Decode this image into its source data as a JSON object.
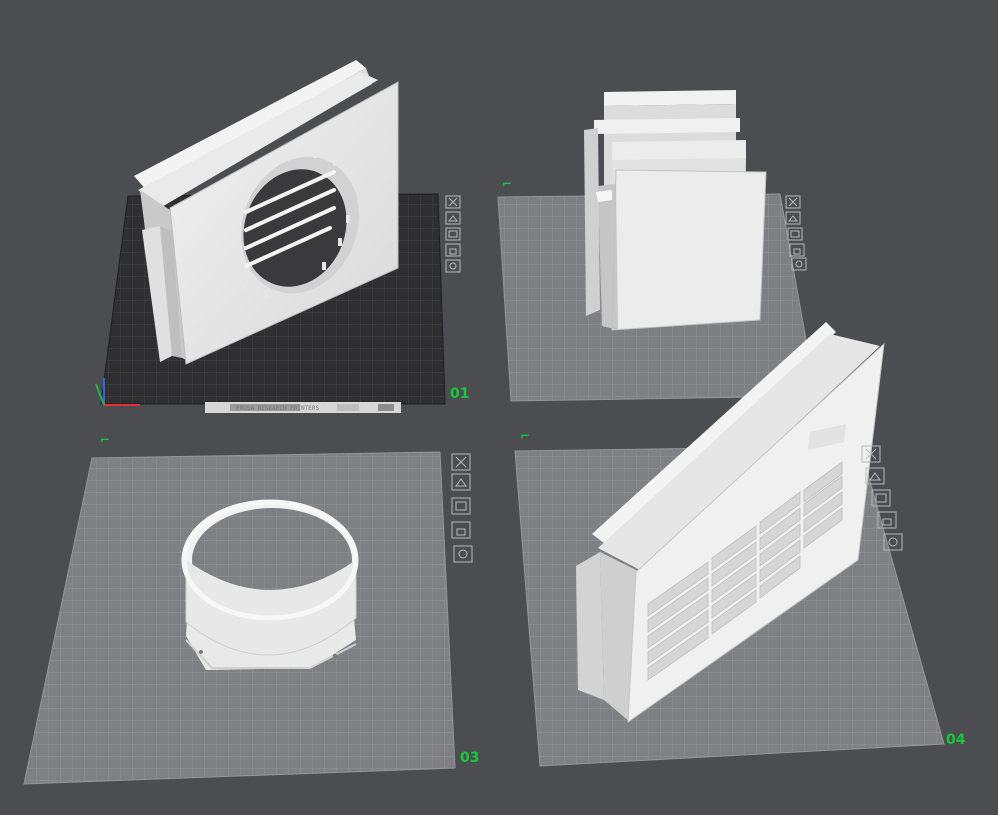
{
  "plates": [
    {
      "id": "plate-01",
      "label": "01",
      "active": true,
      "part": "fan-mount-with-grille"
    },
    {
      "id": "plate-02",
      "label": "",
      "active": false,
      "part": "duct-panels-stack"
    },
    {
      "id": "plate-03",
      "label": "03",
      "active": false,
      "part": "duct-collar-ring"
    },
    {
      "id": "plate-04",
      "label": "04",
      "active": false,
      "part": "louvered-vent-panel"
    }
  ],
  "plate_tools": [
    "delete-plate",
    "arrange-plate",
    "plate-settings",
    "lock-plate",
    "orient-plate"
  ],
  "bed_branding": "PRUSA RESEARCH PRINTERS",
  "bed_sub": "SMOOTH PEI",
  "colors": {
    "background": "#4c4d51",
    "active_bed": "#2d2d2f",
    "inactive_bed": "#7f8084",
    "model": "#e4e4e4",
    "label_green": "#17c93a"
  }
}
